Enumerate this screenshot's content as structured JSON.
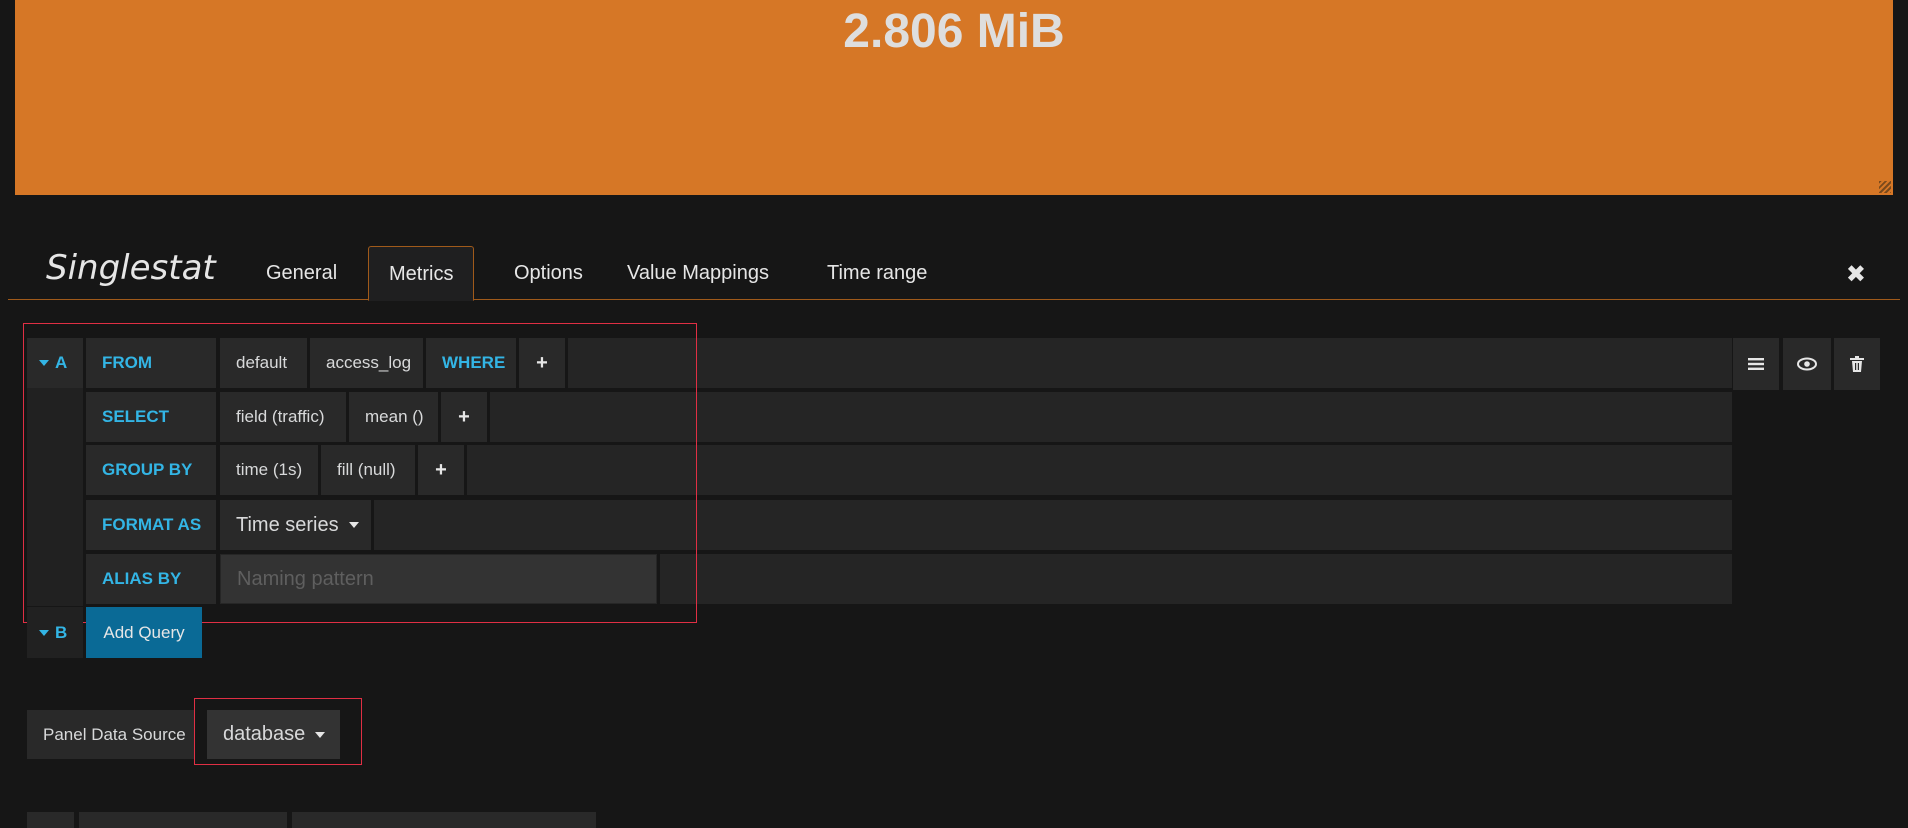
{
  "stat": {
    "value": "2.806 MiB",
    "background": "#d67726"
  },
  "editor": {
    "title": "Singlestat",
    "tabs": [
      "General",
      "Metrics",
      "Options",
      "Value Mappings",
      "Time range"
    ],
    "active_tab": "Metrics",
    "close_icon": "close-icon"
  },
  "query_a": {
    "ref": "A",
    "from_label": "FROM",
    "from_policy": "default",
    "from_measurement": "access_log",
    "where_label": "WHERE",
    "select_label": "SELECT",
    "select_field": "field (traffic)",
    "select_fn": "mean ()",
    "group_by_label": "GROUP BY",
    "group_time": "time (1s)",
    "group_fill": "fill (null)",
    "format_label": "FORMAT AS",
    "format_value": "Time series",
    "alias_label": "ALIAS BY",
    "alias_placeholder": "Naming pattern",
    "add_symbol": "+"
  },
  "query_b": {
    "ref": "B",
    "add_query_label": "Add Query"
  },
  "datasource": {
    "label": "Panel Data Source",
    "value": "database"
  },
  "colors": {
    "keyword": "#33b5e5",
    "accent": "#d67726",
    "highlight": "#e02f44",
    "primary_button": "#0a6a96"
  }
}
